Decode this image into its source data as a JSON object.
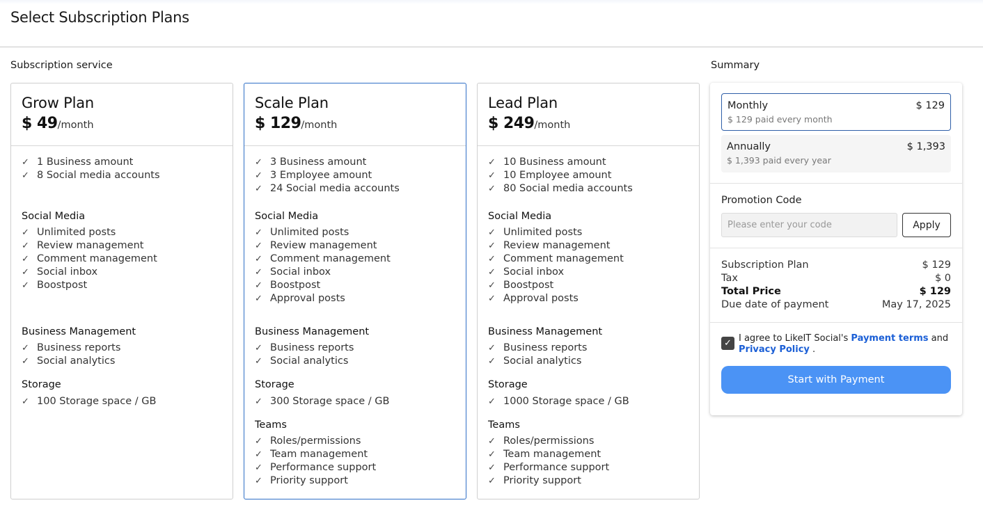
{
  "page": {
    "title": "Select Subscription Plans"
  },
  "sections": {
    "service_label": "Subscription service",
    "summary_label": "Summary"
  },
  "plans": [
    {
      "name": "Grow Plan",
      "price": "$ 49",
      "period": "/month",
      "base": [
        "1 Business amount",
        "8 Social media accounts"
      ],
      "social_title": "Social Media",
      "social": [
        "Unlimited posts",
        "Review management",
        "Comment management",
        "Social inbox",
        "Boostpost"
      ],
      "biz_title": "Business Management",
      "biz": [
        "Business reports",
        "Social analytics"
      ],
      "storage_title": "Storage",
      "storage": [
        "100 Storage space / GB"
      ]
    },
    {
      "name": "Scale Plan",
      "price": "$ 129",
      "period": "/month",
      "base": [
        "3 Business amount",
        "3 Employee amount",
        "24 Social media accounts"
      ],
      "social_title": "Social Media",
      "social": [
        "Unlimited posts",
        "Review management",
        "Comment management",
        "Social inbox",
        "Boostpost",
        "Approval posts"
      ],
      "biz_title": "Business Management",
      "biz": [
        "Business reports",
        "Social analytics"
      ],
      "storage_title": "Storage",
      "storage": [
        "300 Storage space / GB"
      ],
      "teams_title": "Teams",
      "teams": [
        "Roles/permissions",
        "Team management",
        "Performance support",
        "Priority support"
      ]
    },
    {
      "name": "Lead Plan",
      "price": "$ 249",
      "period": "/month",
      "base": [
        "10 Business amount",
        "10 Employee amount",
        "80 Social media accounts"
      ],
      "social_title": "Social Media",
      "social": [
        "Unlimited posts",
        "Review management",
        "Comment management",
        "Social inbox",
        "Boostpost",
        "Approval posts"
      ],
      "biz_title": "Business Management",
      "biz": [
        "Business reports",
        "Social analytics"
      ],
      "storage_title": "Storage",
      "storage": [
        "1000 Storage space / GB"
      ],
      "teams_title": "Teams",
      "teams": [
        "Roles/permissions",
        "Team management",
        "Performance support",
        "Priority support"
      ]
    }
  ],
  "summary": {
    "monthly": {
      "label": "Monthly",
      "price": "$ 129",
      "note": "$ 129 paid every month"
    },
    "annually": {
      "label": "Annually",
      "price": "$ 1,393",
      "note": "$ 1,393 paid every year"
    },
    "promo": {
      "label": "Promotion Code",
      "placeholder": "Please enter your code",
      "apply": "Apply"
    },
    "totals": {
      "plan_label": "Subscription Plan",
      "plan_value": "$ 129",
      "tax_label": "Tax",
      "tax_value": "$ 0",
      "total_label": "Total Price",
      "total_value": "$ 129",
      "due_label": "Due date of payment",
      "due_value": "May 17, 2025"
    },
    "agree": {
      "prefix": "I agree to LikeIT Social's ",
      "terms": "Payment terms",
      "and": " and",
      "privacy": "Privacy Policy",
      "suffix": " ."
    },
    "pay_button": "Start with Payment"
  },
  "icons": {
    "feature": "check-icon",
    "checkbox": "checkbox-checked-icon"
  },
  "colors": {
    "accent": "#4b93f5",
    "selected_border": "#2f6fc6",
    "link": "#1b5fd6"
  }
}
